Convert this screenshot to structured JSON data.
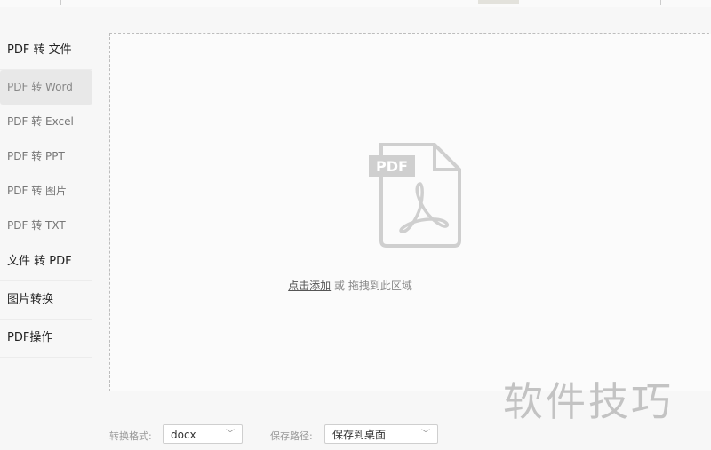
{
  "sidebar": {
    "groups": [
      {
        "label": "PDF 转 文件"
      },
      {
        "label": "文件 转 PDF"
      },
      {
        "label": "图片转换"
      },
      {
        "label": "PDF操作"
      }
    ],
    "items": [
      {
        "label": "PDF 转 Word",
        "active": true
      },
      {
        "label": "PDF 转 Excel"
      },
      {
        "label": "PDF 转 PPT"
      },
      {
        "label": "PDF 转 图片"
      },
      {
        "label": "PDF 转 TXT"
      }
    ]
  },
  "dropzone": {
    "icon": "pdf-file-icon",
    "icon_label": "PDF",
    "link_text": "点击添加",
    "hint_text": " 或 拖拽到此区域"
  },
  "bottombar": {
    "format_label": "转换格式:",
    "format_value": "docx",
    "path_label": "保存路径:",
    "path_value": "保存到桌面"
  },
  "watermark": "软件技巧"
}
